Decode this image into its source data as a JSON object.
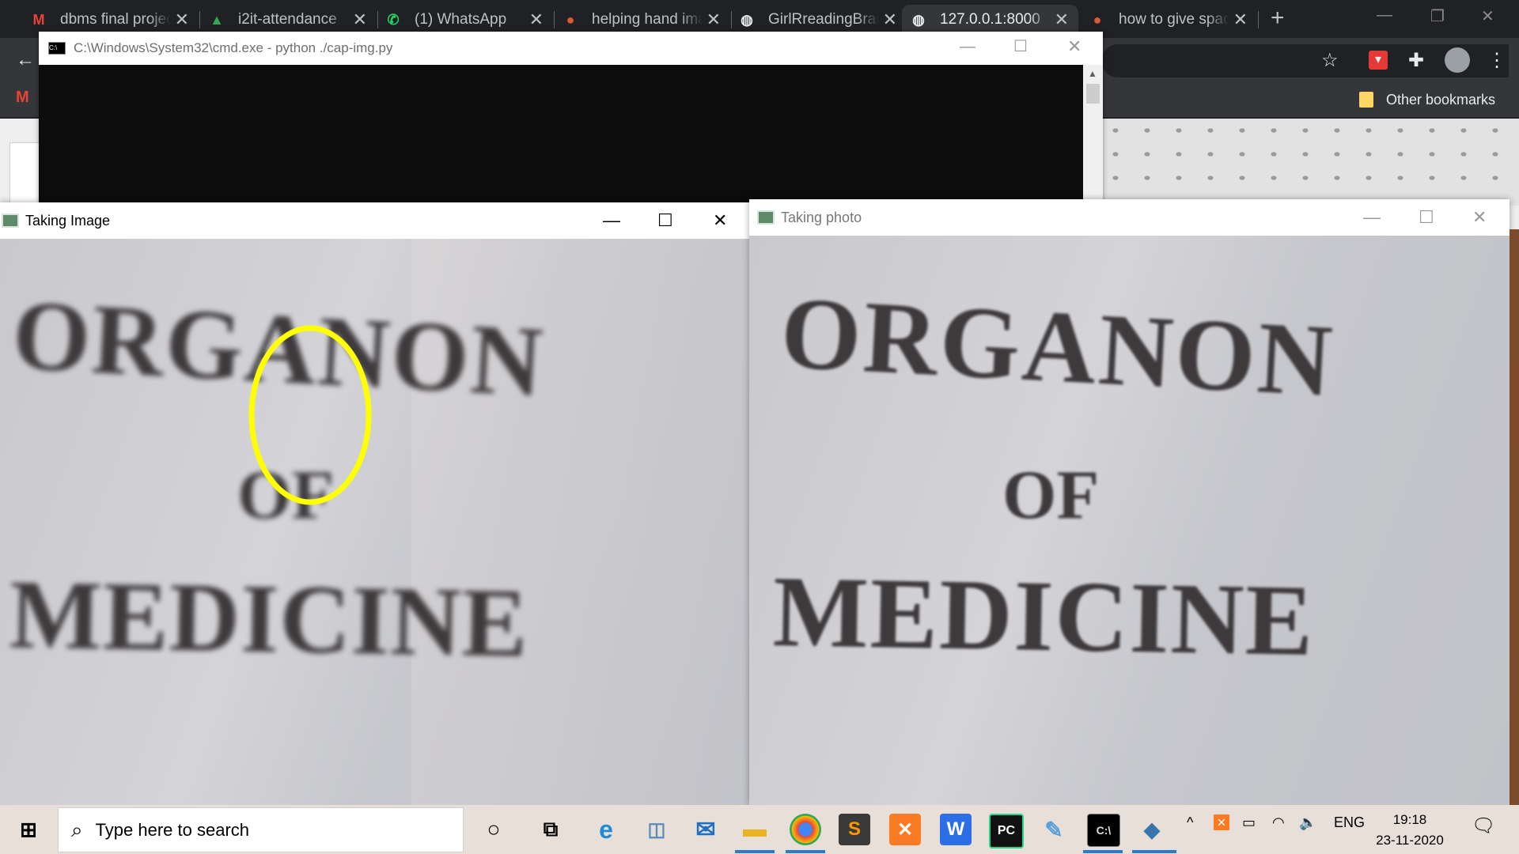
{
  "browser": {
    "tabs": [
      {
        "title": "dbms final project",
        "icon": "gmail-icon",
        "fav": "M",
        "color": "#ea4335"
      },
      {
        "title": "i2it-attendance",
        "icon": "drive-icon",
        "fav": "▲",
        "color": "#34a853"
      },
      {
        "title": "(1) WhatsApp",
        "icon": "whatsapp-icon",
        "fav": "✆",
        "color": "#25d366"
      },
      {
        "title": "helping hand image",
        "icon": "duckduckgo-icon",
        "fav": "●",
        "color": "#de5833"
      },
      {
        "title": "GirlRreadingBrain",
        "icon": "globe-icon",
        "fav": "◍",
        "color": "#e8eaed"
      },
      {
        "title": "127.0.0.1:8000",
        "icon": "globe-icon",
        "fav": "◍",
        "color": "#e8eaed"
      },
      {
        "title": "how to give space",
        "icon": "duckduckgo-icon",
        "fav": "●",
        "color": "#de5833"
      }
    ],
    "active_tab": 5,
    "bookmarks": {
      "other": "Other bookmarks"
    }
  },
  "cmd_window": {
    "title": "C:\\Windows\\System32\\cmd.exe - python  ./cap-img.py"
  },
  "window_left": {
    "title": "Taking Image",
    "text": {
      "line1": "ORGANON",
      "line2": "OF",
      "line3": "MEDICINE"
    },
    "annotation_color": "#ffff00"
  },
  "window_right": {
    "title": "Taking photo",
    "text": {
      "line1": "ORGANON",
      "line2": "OF",
      "line3": "MEDICINE"
    }
  },
  "taskbar": {
    "search_placeholder": "Type here to search",
    "lang": "ENG",
    "time": "19:18",
    "date": "23-11-2020"
  }
}
